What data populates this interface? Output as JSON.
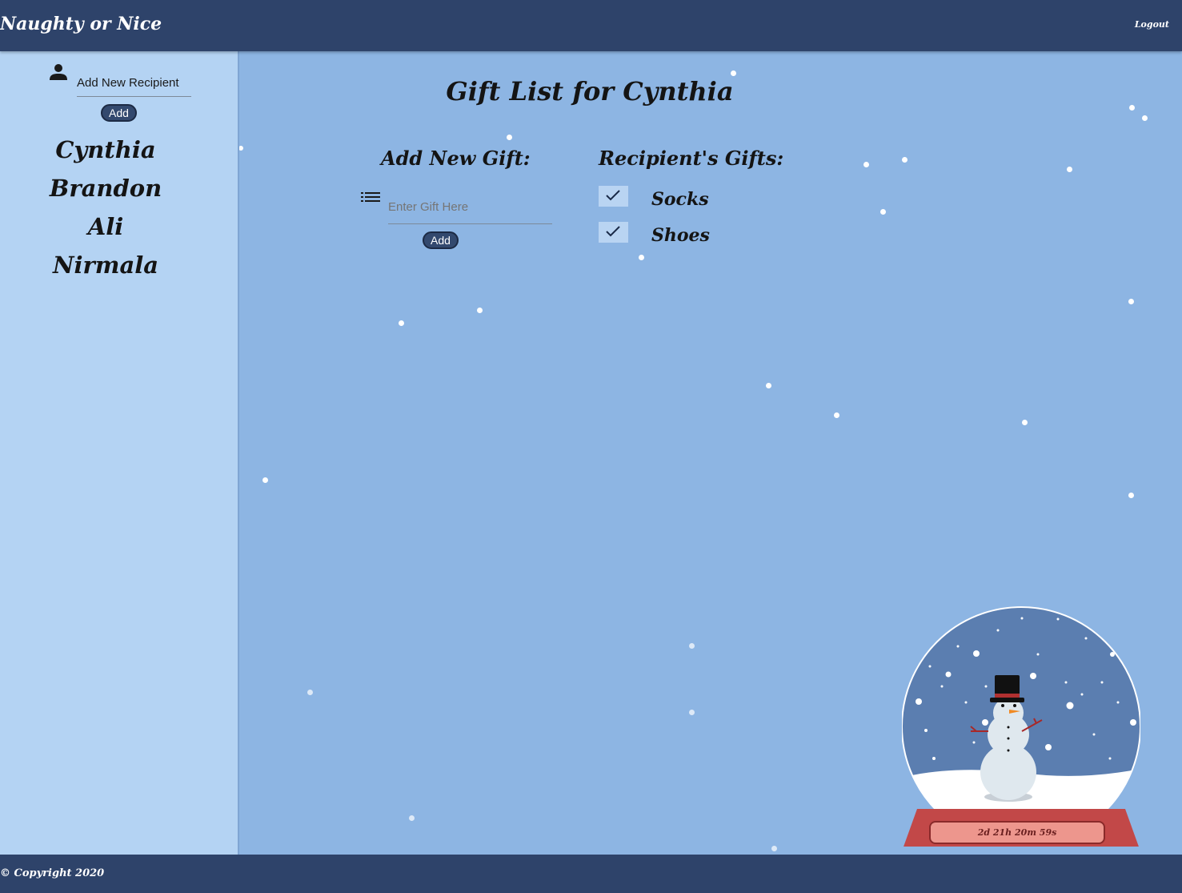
{
  "app": {
    "title": "Naughty or Nice",
    "logout_label": "Logout"
  },
  "sidebar": {
    "icon": "person-icon",
    "recipient_input_value": "Add New Recipient",
    "add_button_label": "Add",
    "recipients": [
      "Cynthia",
      "Brandon",
      "Ali",
      "Nirmala"
    ]
  },
  "main": {
    "title": "Gift List for Cynthia",
    "add_gift": {
      "heading": "Add New Gift:",
      "icon": "list-icon",
      "placeholder": "Enter Gift Here",
      "button_label": "Add"
    },
    "recipient_gifts": {
      "heading": "Recipient's Gifts:",
      "items": [
        {
          "name": "Socks",
          "checked": true
        },
        {
          "name": "Shoes",
          "checked": true
        }
      ]
    }
  },
  "snow_globe": {
    "countdown": "2d 21h 20m 59s"
  },
  "footer": {
    "copyright": "© Copyright 2020"
  },
  "colors": {
    "header": "#2e436a",
    "sidebar": "#b4d3f3",
    "main_background": "#8db5e3",
    "globe_base": "#c24848",
    "countdown_background": "#ed968d"
  }
}
